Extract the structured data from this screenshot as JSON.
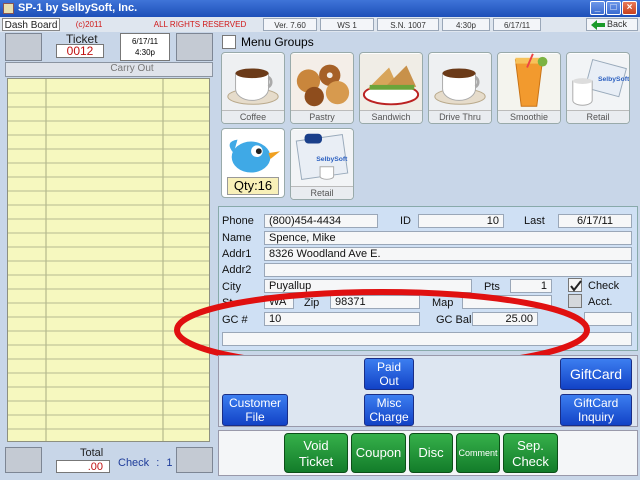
{
  "window": {
    "title": "SP-1 by SelbySoft, Inc."
  },
  "statusbar": {
    "tab": "Dash Board",
    "copyright": "(c)2011",
    "rights": "ALL RIGHTS RESERVED",
    "version": "Ver. 7.60",
    "ws": "WS 1",
    "sn": "S.N. 1007",
    "time": "4:30p",
    "date": "6/17/11",
    "back_label": "Back"
  },
  "ticket": {
    "label": "Ticket",
    "number": "0012",
    "date": "6/17/11",
    "time": "4:30p",
    "order_type": "Carry Out",
    "total_label": "Total",
    "total_value": ".00",
    "check_label": "Check",
    "check_sep": ":",
    "check_num": "1"
  },
  "menu": {
    "groups_label": "Menu Groups",
    "tiles": [
      {
        "label": "Coffee",
        "icon": "coffee-cup-icon"
      },
      {
        "label": "Pastry",
        "icon": "pastry-icon"
      },
      {
        "label": "Sandwich",
        "icon": "sandwich-icon"
      },
      {
        "label": "Drive Thru",
        "icon": "coffee-cup-icon"
      },
      {
        "label": "Smoothie",
        "icon": "smoothie-icon"
      },
      {
        "label": "Retail",
        "icon": "retail-mug-icon"
      }
    ],
    "special_tile": {
      "qty": "Qty:16",
      "icon": "bird-icon"
    },
    "retail2": {
      "label": "Retail",
      "icon": "retail-shirt-icon"
    }
  },
  "customer": {
    "phone_label": "Phone",
    "phone": "(800)454-4434",
    "id_label": "ID",
    "id": "10",
    "last_label": "Last",
    "last": "6/17/11",
    "name_label": "Name",
    "name": "Spence, Mike",
    "addr1_label": "Addr1",
    "addr1": "8326 Woodland Ave E.",
    "addr2_label": "Addr2",
    "addr2": "",
    "city_label": "City",
    "city": "Puyallup",
    "pts_label": "Pts",
    "pts": "1",
    "check_label": "Check",
    "acct_label": "Acct.",
    "state_label": "St",
    "state": "WA",
    "zip_label": "Zip",
    "zip": "98371",
    "map_label": "Map",
    "gc_label": "GC #",
    "gc": "10",
    "gcbal_label": "GC Bal",
    "gcbal": "25.00"
  },
  "buttons": {
    "paid_out": [
      "Paid",
      "Out"
    ],
    "giftcard": "GiftCard",
    "customer_file": [
      "Customer",
      "File"
    ],
    "misc_charge": [
      "Misc",
      "Charge"
    ],
    "giftcard_inquiry": [
      "GiftCard",
      "Inquiry"
    ],
    "void_ticket": [
      "Void",
      "Ticket"
    ],
    "coupon": "Coupon",
    "disc": "Disc",
    "comment": "Comment",
    "sep_check": [
      "Sep.",
      "Check"
    ]
  },
  "colors": {
    "grid_bg": "#f6f8bf",
    "button_blue": "#1e5ae0",
    "button_green": "#1f9436",
    "annotation_red": "#e01010"
  }
}
